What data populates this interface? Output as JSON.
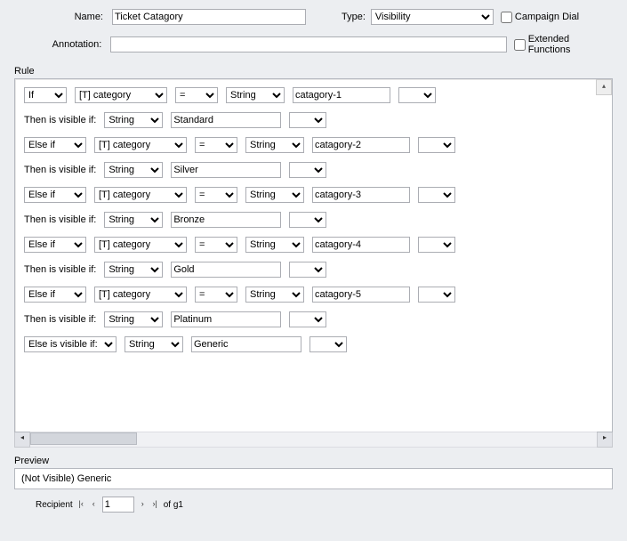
{
  "form": {
    "name_label": "Name:",
    "name_value": "Ticket Catagory",
    "type_label": "Type:",
    "type_value": "Visibility",
    "campaign_dial_label": "Campaign Dial",
    "annotation_label": "Annotation:",
    "annotation_value": "",
    "extended_label": "Extended Functions"
  },
  "rule": {
    "title": "Rule",
    "lines": [
      {
        "kind": "if",
        "cond": "If",
        "field": "[T] category",
        "op": "=",
        "type": "String",
        "value": "catagory-1"
      },
      {
        "kind": "then",
        "label": "Then is visible if:",
        "type": "String",
        "value": "Standard"
      },
      {
        "kind": "elif",
        "cond": "Else if",
        "field": "[T] category",
        "op": "=",
        "type": "String",
        "value": "catagory-2"
      },
      {
        "kind": "then",
        "label": "Then is visible if:",
        "type": "String",
        "value": "Silver"
      },
      {
        "kind": "elif",
        "cond": "Else if",
        "field": "[T] category",
        "op": "=",
        "type": "String",
        "value": "catagory-3"
      },
      {
        "kind": "then",
        "label": "Then is visible if:",
        "type": "String",
        "value": "Bronze"
      },
      {
        "kind": "elif",
        "cond": "Else if",
        "field": "[T] category",
        "op": "=",
        "type": "String",
        "value": "catagory-4"
      },
      {
        "kind": "then",
        "label": "Then is visible if:",
        "type": "String",
        "value": "Gold"
      },
      {
        "kind": "elif",
        "cond": "Else if",
        "field": "[T] category",
        "op": "=",
        "type": "String",
        "value": "catagory-5"
      },
      {
        "kind": "then",
        "label": "Then is visible if:",
        "type": "String",
        "value": "Platinum"
      },
      {
        "kind": "else",
        "cond": "Else is visible if:",
        "type": "String",
        "value": "Generic"
      }
    ]
  },
  "preview": {
    "title": "Preview",
    "text": "(Not Visible) Generic"
  },
  "recipient": {
    "label": "Recipient",
    "page": "1",
    "of_text": "of g1"
  }
}
